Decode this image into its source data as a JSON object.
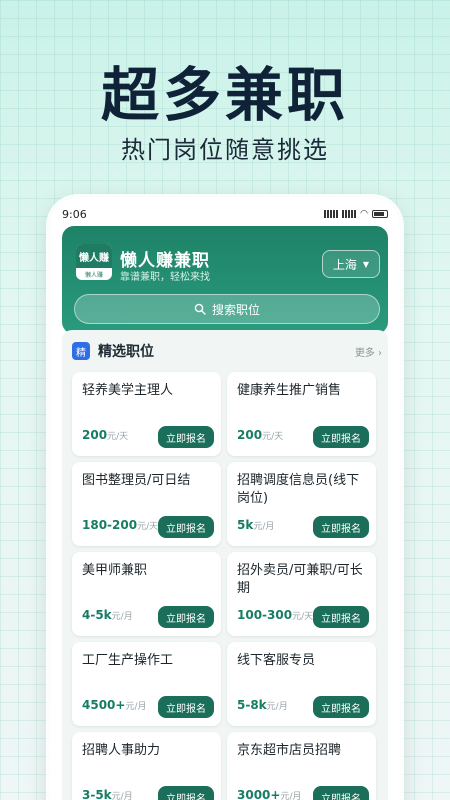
{
  "promo": {
    "headline": "超多兼职",
    "subline": "热门岗位随意挑选"
  },
  "status_bar": {
    "time": "9:06"
  },
  "app": {
    "name": "懒人赚兼职",
    "slogan": "靠谱兼职，轻松来找",
    "logo_text": "懒人赚",
    "logo_sub": "懒人赚"
  },
  "location": {
    "city": "上海"
  },
  "search": {
    "placeholder": "搜索职位"
  },
  "section": {
    "icon_text": "精",
    "title": "精选职位",
    "more": "更多"
  },
  "jobs": [
    {
      "title": "轻养美学主理人",
      "salary": "200",
      "unit": "元/天",
      "button": "立即报名"
    },
    {
      "title": "健康养生推广销售",
      "salary": "200",
      "unit": "元/天",
      "button": "立即报名"
    },
    {
      "title": "图书整理员/可日结",
      "salary": "180-200",
      "unit": "元/天",
      "button": "立即报名"
    },
    {
      "title": "招聘调度信息员(线下岗位)",
      "salary": "5k",
      "unit": "元/月",
      "button": "立即报名"
    },
    {
      "title": "美甲师兼职",
      "salary": "4-5k",
      "unit": "元/月",
      "button": "立即报名"
    },
    {
      "title": "招外卖员/可兼职/可长期",
      "salary": "100-300",
      "unit": "元/天",
      "button": "立即报名"
    },
    {
      "title": "工厂生产操作工",
      "salary": "4500+",
      "unit": "元/月",
      "button": "立即报名"
    },
    {
      "title": "线下客服专员",
      "salary": "5-8k",
      "unit": "元/月",
      "button": "立即报名"
    },
    {
      "title": "招聘人事助力",
      "salary": "3-5k",
      "unit": "元/月",
      "button": "立即报名"
    },
    {
      "title": "京东超市店员招聘",
      "salary": "3000+",
      "unit": "元/月",
      "button": "立即报名"
    }
  ],
  "colors": {
    "brand": "#1e8267",
    "button": "#1a6e5a",
    "salary": "#167d63",
    "headline": "#0f2237"
  }
}
